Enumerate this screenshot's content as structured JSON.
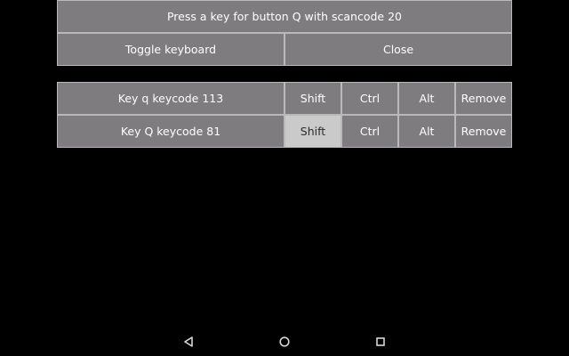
{
  "header": {
    "prompt": "Press a key for button Q with scancode 20"
  },
  "actions": {
    "toggle_keyboard": "Toggle keyboard",
    "close": "Close"
  },
  "mappings": [
    {
      "label": "Key q keycode 113",
      "shift": "Shift",
      "ctrl": "Ctrl",
      "alt": "Alt",
      "remove": "Remove",
      "shift_active": false
    },
    {
      "label": "Key Q keycode 81",
      "shift": "Shift",
      "ctrl": "Ctrl",
      "alt": "Alt",
      "remove": "Remove",
      "shift_active": true
    }
  ],
  "navbar": {
    "back": "back-triangle-icon",
    "home": "home-circle-icon",
    "recents": "recents-square-icon"
  },
  "colors": {
    "button_bg": "#7e7c7e",
    "button_pressed_bg": "#cbcacb",
    "border": "#b9b9b9",
    "background": "#000000"
  }
}
